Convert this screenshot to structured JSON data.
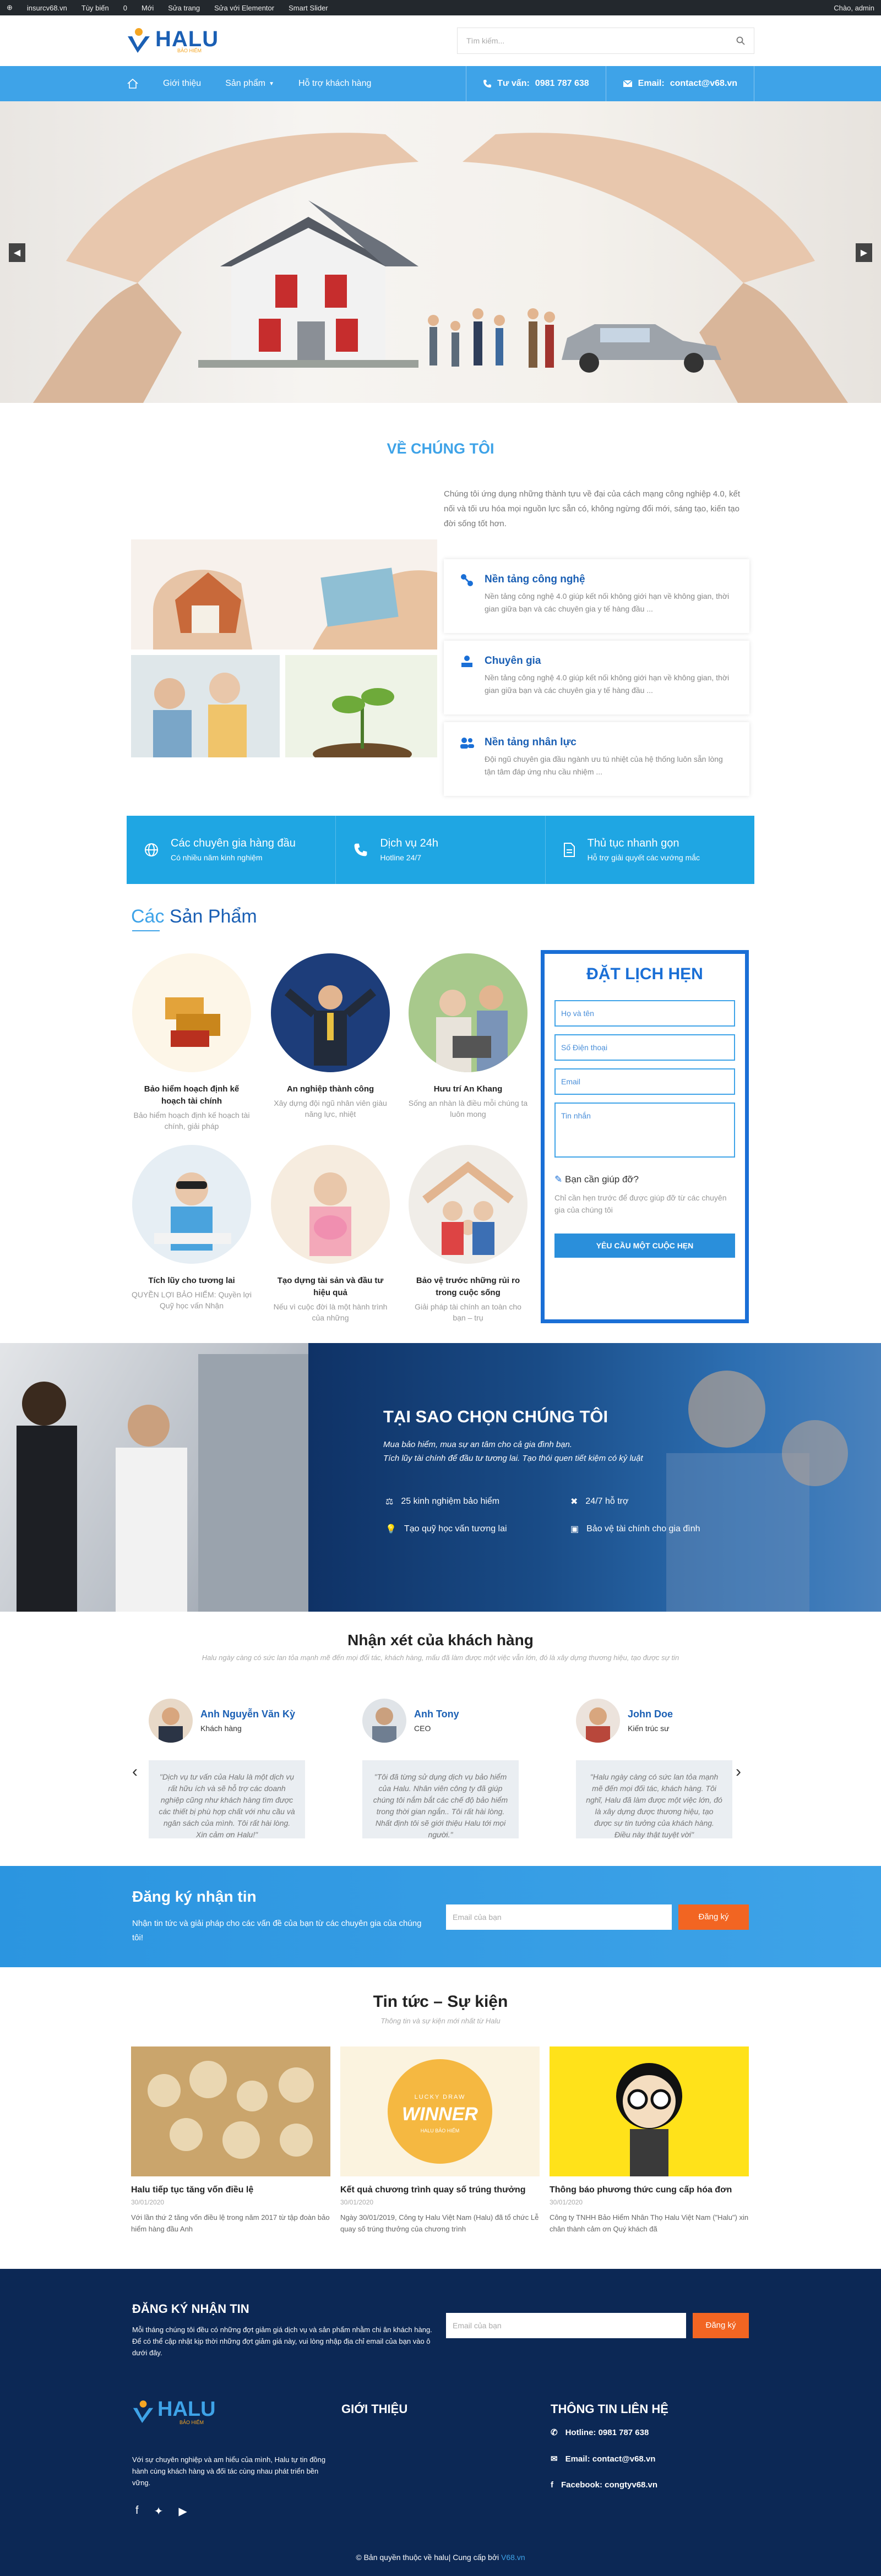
{
  "admin_bar": {
    "site": "insurcv68.vn",
    "customize": "Tùy biến",
    "count": "0",
    "new": "Mới",
    "edit_page": "Sửa trang",
    "edit_elementor": "Sửa với Elementor",
    "smart_slider": "Smart Slider",
    "greeting": "Chào, admin"
  },
  "header": {
    "logo_text": "HALU",
    "logo_sub": "BẢO HIỂM",
    "search_placeholder": "Tìm kiếm..."
  },
  "nav": {
    "items": [
      "Giới thiệu",
      "Sản phẩm",
      "Hỗ trợ khách hàng"
    ],
    "phone_label": "Tư vấn:",
    "phone": "0981 787 638",
    "email_label": "Email:",
    "email": "contact@v68.vn"
  },
  "about": {
    "title": "VỀ CHÚNG TÔI",
    "intro": "Chúng tôi ứng dụng những thành tựu về đại của cách mạng công nghiệp 4.0, kết nối và tối ưu hóa mọi nguồn lực sẵn có, không ngừng đổi mới, sáng tạo, kiến tạo đời sống tốt hơn.",
    "features": [
      {
        "title": "Nền tảng công nghệ",
        "text": "Nền tảng công nghệ 4.0 giúp kết nối không giới hạn về không gian, thời gian giữa bạn và các chuyên gia y tế hàng đầu ..."
      },
      {
        "title": "Chuyên gia",
        "text": "Nền tảng công nghệ 4.0 giúp kết nối không giới hạn về không gian, thời gian giữa bạn và các chuyên gia y tế hàng đầu ..."
      },
      {
        "title": "Nền tảng nhân lực",
        "text": "Đội ngũ chuyên gia đầu ngành ưu tú nhiệt của hệ thống luôn sẵn lòng tận tâm đáp ứng nhu cầu nhiệm ..."
      }
    ]
  },
  "strip": [
    {
      "title": "Các chuyên gia hàng đầu",
      "sub": "Có nhiều năm kinh nghiệm"
    },
    {
      "title": "Dịch vụ 24h",
      "sub": "Hotline 24/7"
    },
    {
      "title": "Thủ tục nhanh gọn",
      "sub": "Hỗ trợ giải quyết các vướng mắc"
    }
  ],
  "products": {
    "title_a": "Các",
    "title_b": "Sản Phẩm",
    "items": [
      {
        "title": "Bảo hiểm hoạch định kế hoạch tài chính",
        "text": "Bảo hiểm hoạch định kế hoạch tài chính, giải pháp"
      },
      {
        "title": "An nghiệp thành công",
        "text": "Xây dựng đội ngũ nhân viên giàu năng lực, nhiệt"
      },
      {
        "title": "Hưu trí An Khang",
        "text": "Sống an nhàn là điều mỗi chúng ta luôn mong"
      },
      {
        "title": "Tích lũy cho tương lai",
        "text": "QUYỀN LỢI BẢO HIỂM: Quyền lợi Quỹ học vấn Nhận"
      },
      {
        "title": "Tạo dựng tài sản và đầu tư hiệu quả",
        "text": "Nếu vì cuộc đời là một hành trình của những"
      },
      {
        "title": "Bảo vệ trước những rủi ro trong cuộc sống",
        "text": "Giải pháp tài chính an toàn cho bạn – trụ"
      }
    ]
  },
  "booking": {
    "title": "ĐẶT LỊCH HẸN",
    "name": "Họ và tên",
    "phone": "Số Điện thoại",
    "email": "Email",
    "message": "Tin nhắn",
    "help": "Bạn cần giúp đỡ?",
    "desc": "Chỉ cần hẹn trước để được giúp đỡ từ các chuyên gia của chúng tôi",
    "button": "YÊU CẦU MỘT CUỘC HẸN"
  },
  "why": {
    "title": "TẠI SAO CHỌN CHÚNG TÔI",
    "lead1": "Mua bảo hiểm, mua sự an tâm cho cả gia đình bạn.",
    "lead2": "Tích lũy tài chính để đầu tư tương lai. Tạo thói quen tiết kiệm có kỷ luật",
    "points": [
      "25 kinh nghiệm bảo hiểm",
      "24/7 hỗ trợ",
      "Tạo quỹ học vấn tương lai",
      "Bảo vệ tài chính cho gia đình"
    ]
  },
  "testimonials": {
    "title": "Nhận xét của khách hàng",
    "sub": "Halu ngày càng có sức lan tỏa mạnh mẽ đến mọi đối tác, khách hàng, mấu đã làm được một việc vẫn lớn, đó là xây dựng thương hiệu, tạo được sự tin",
    "items": [
      {
        "name": "Anh Nguyễn Văn Kỳ",
        "role": "Khách hàng",
        "quote": "\"Dịch vụ tư vấn của Halu là một dịch vụ rất hữu ích và sẽ hỗ trợ các doanh nghiệp cũng như khách hàng tìm được các thiết bị phù hợp chất với nhu cầu và ngân sách của mình. Tôi rất hài lòng. Xin cảm ơn Halu!\""
      },
      {
        "name": "Anh Tony",
        "role": "CEO",
        "quote": "\"Tôi đã từng sử dụng dịch vụ bảo hiểm của Halu. Nhân viên công ty đã giúp chúng tôi nắm bắt các chế độ bảo hiểm trong thời gian ngắn.. Tôi rất hài lòng. Nhất định tôi sẽ giới thiệu Halu tới mọi người.\""
      },
      {
        "name": "John Doe",
        "role": "Kiến trúc sư",
        "quote": "\"Halu ngày càng có sức lan tỏa mạnh mẽ đến mọi đối tác, khách hàng. Tôi nghĩ, Halu đã làm được một việc lớn, đó là xây dựng được thương hiệu, tạo được sự tin tưởng của khách hàng. Điều này thật tuyệt vời\""
      }
    ]
  },
  "newsletter": {
    "title": "Đăng ký nhận tin",
    "text": "Nhận tin tức và giải pháp cho các vấn đề của bạn từ các chuyên gia của chúng tôi!",
    "placeholder": "Email của bạn",
    "button": "Đăng ký"
  },
  "news": {
    "title": "Tin tức – Sự kiện",
    "sub": "Thông tin và sự kiện mới nhất từ Halu",
    "items": [
      {
        "title": "Halu tiếp tục tăng vốn điều lệ",
        "date": "30/01/2020",
        "text": "Với lần thứ 2 tăng vốn điều lệ trong năm 2017 từ tập đoàn bảo hiểm hàng đầu Anh"
      },
      {
        "title": "Kết quả chương trình quay số trúng thưởng",
        "date": "30/01/2020",
        "text": "Ngày 30/01/2019, Công ty Halu Việt Nam (Halu) đã tổ chức Lễ quay số trúng thưởng của chương trình"
      },
      {
        "title": "Thông báo phương thức cung cấp hóa đơn",
        "date": "30/01/2020",
        "text": "Công ty TNHH Bảo Hiểm Nhân Thọ Halu Việt Nam (\"Halu\") xin chân thành cảm ơn Quý khách đã"
      }
    ],
    "winner_top": "LUCKY DRAW",
    "winner": "WINNER",
    "winner_bot": "HALU BẢO HIỂM"
  },
  "footer": {
    "news_title": "ĐĂNG KÝ NHẬN TIN",
    "news_text": "Mỗi tháng chúng tôi đều có những đợt giảm giá dịch vụ và sản phẩm nhằm chi ân khách hàng. Để có thể cập nhật kịp thời những đợt giảm giá này, vui lòng nhập địa chỉ email của bạn vào ô dưới đây.",
    "placeholder": "Email của bạn",
    "button": "Đăng ký",
    "logo_text": "HALU",
    "logo_sub": "BẢO HIỂM",
    "about_text": "Với sự chuyên nghiệp và am hiểu của mình, Halu tự tin đồng hành cùng khách hàng và đối tác cùng nhau phát triển bền vững.",
    "intro_title": "GIỚI THIỆU",
    "contact_title": "THÔNG TIN LIÊN HỆ",
    "hotline": "Hotline: 0981 787 638",
    "email": "Email: contact@v68.vn",
    "facebook": "Facebook: congtyv68.vn",
    "copyright": "© Bản quyền thuộc về halu| Cung cấp bởi",
    "copyright_link": "V68.vn"
  },
  "colors": {
    "primary": "#3ea3e8",
    "dark": "#1a5fb4",
    "accent": "#f26522",
    "footer": "#0c2855"
  }
}
